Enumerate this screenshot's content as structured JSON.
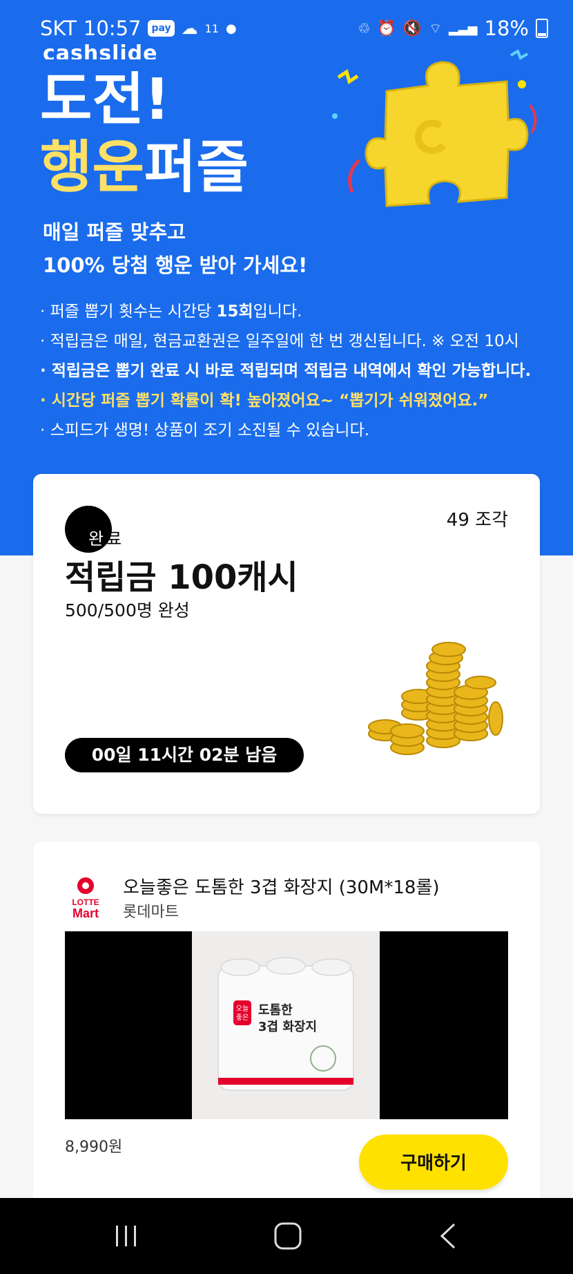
{
  "status_bar": {
    "carrier": "SKT",
    "time": "10:57",
    "pay_badge": "pay",
    "notification_count": "11",
    "battery": "18%"
  },
  "hero": {
    "brand": "cashslide",
    "title_line1": "도전!",
    "title_highlight": "행운",
    "title_rest": "퍼즐",
    "subtitle_line1": "매일 퍼즐 맞추고",
    "subtitle_line2": "100% 당첨 행운 받아 가세요!",
    "notes": {
      "n1_a": "· 퍼즐 뽑기 횟수는 시간당 ",
      "n1_b": "15회",
      "n1_c": "입니다.",
      "n2": "· 적립금은 매일, 현금교환권은 일주일에 한 번 갱신됩니다. ※ 오전 10시",
      "n3": "· 적립금은 뽑기 완료 시 바로 적립되며 적립금 내역에서 확인 가능합니다.",
      "n4": "· 시간당 퍼즐 뽑기 확률이 확! 높아졌어요~ “뽑기가 쉬워졌어요.”",
      "n5": "· 스피드가 생명! 상품이 조기 소진될 수 있습니다."
    },
    "colors": {
      "background": "#1a6cec",
      "highlight": "#ffe066"
    }
  },
  "reward_card": {
    "status_a": "완",
    "status_b": "료",
    "pieces": "49 조각",
    "reward": "적립금 100캐시",
    "progress": "500/500명 완성",
    "timer": "00일 11시간 02분 남음",
    "image": "gold-coins"
  },
  "product_card": {
    "logo_top": "LOTTE",
    "logo_bottom": "Mart",
    "name": "오늘좋은 도톰한 3겹 화장지 (30M*18롤)",
    "seller": "롯데마트",
    "pack_brand_a": "오늘",
    "pack_brand_b": "좋은",
    "pack_line1": "도톰한",
    "pack_line2": "3겹 화장지",
    "price": "8,990원",
    "buy_label": "구매하기",
    "button_color": "#ffe100"
  },
  "nav_bar": {
    "recents_icon": "recents-icon",
    "home_icon": "home-icon",
    "back_icon": "back-icon"
  }
}
